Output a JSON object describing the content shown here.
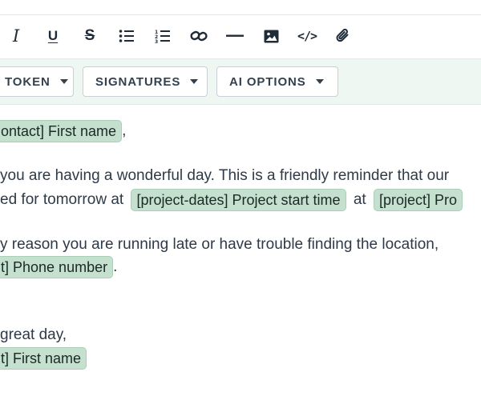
{
  "format_toolbar": {
    "items": [
      {
        "name": "italic-icon",
        "glyph": "I"
      },
      {
        "name": "underline-icon",
        "glyph": "U"
      },
      {
        "name": "strikethrough-icon",
        "glyph": "S"
      },
      {
        "name": "bullet-list-icon"
      },
      {
        "name": "numbered-list-icon"
      },
      {
        "name": "link-icon"
      },
      {
        "name": "horizontal-rule-icon"
      },
      {
        "name": "image-icon"
      },
      {
        "name": "code-icon",
        "glyph": "</>"
      },
      {
        "name": "attachment-icon"
      }
    ]
  },
  "token_toolbar": {
    "token_label": "TOKEN",
    "signatures_label": "SIGNATURES",
    "ai_options_label": "AI OPTIONS"
  },
  "editor": {
    "greeting_chip": "ontact] First name",
    "greeting_tail": ",",
    "para1_line1": "you are having a wonderful day. This is a friendly reminder that our",
    "para1_line2_text": "ed for tomorrow at",
    "chip_start_time": "[project-dates] Project start time",
    "para1_line2_at": "at",
    "chip_project": "[project] Pro",
    "para2_line1": "y reason you are running late or have trouble finding the location,",
    "chip_phone": "t] Phone number",
    "para2_tail": ".",
    "closing": "great day,",
    "chip_signoff": "t] First name"
  }
}
